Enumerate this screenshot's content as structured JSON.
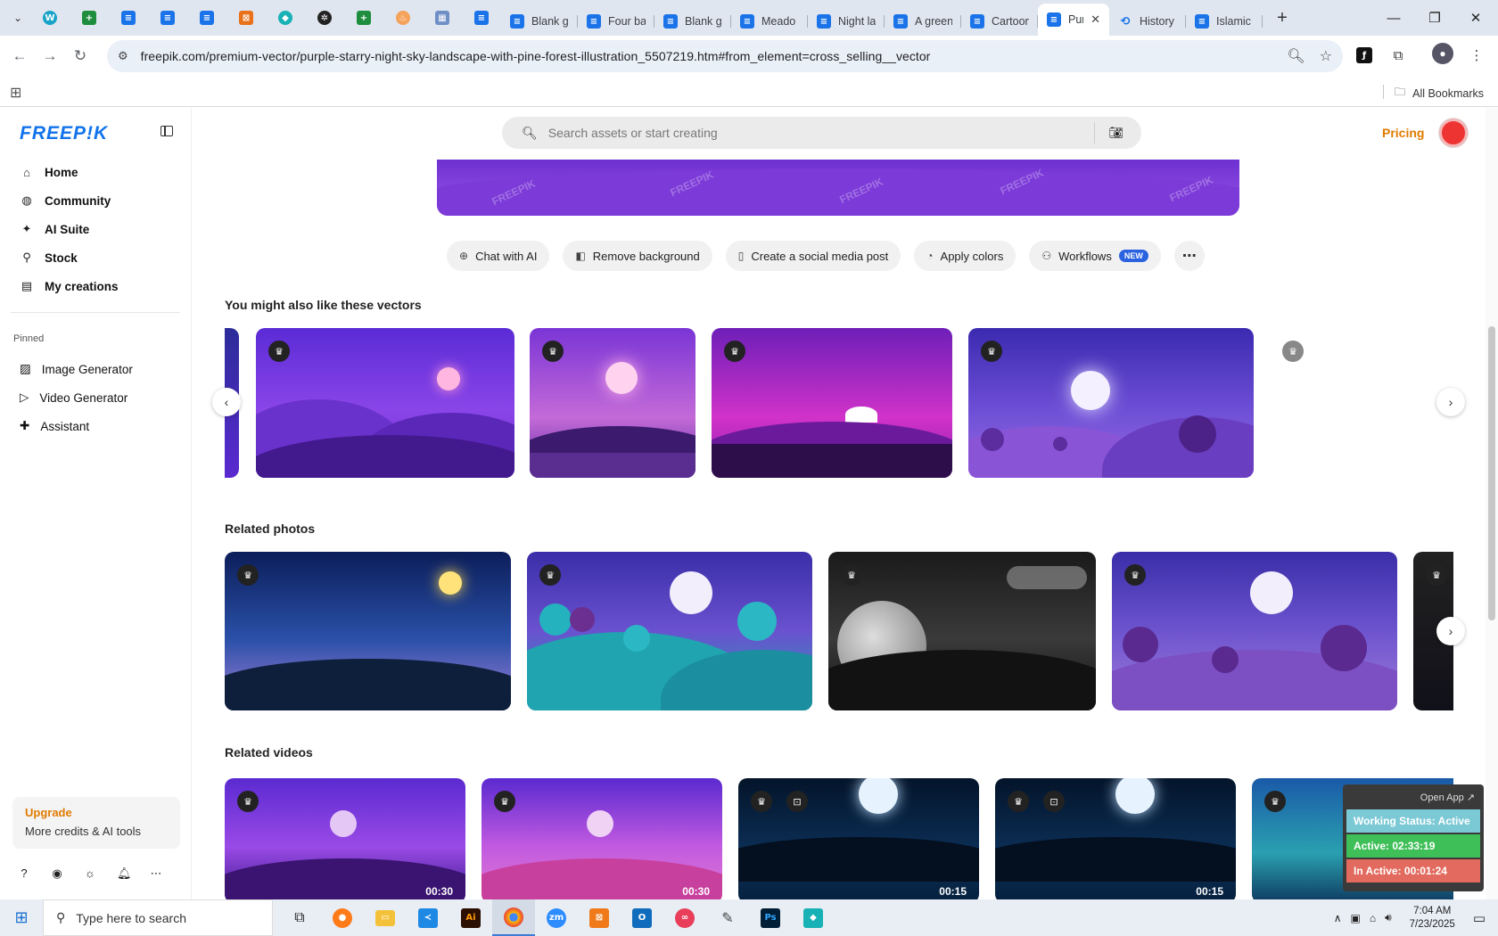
{
  "browser": {
    "tabs": [
      {
        "title": "Blank g",
        "icon": "docs-icon",
        "color": "#1a73e8"
      },
      {
        "title": "Four ba",
        "icon": "docs-icon",
        "color": "#1a73e8"
      },
      {
        "title": "Blank g",
        "icon": "docs-icon",
        "color": "#1a73e8"
      },
      {
        "title": "Meado",
        "icon": "docs-icon",
        "color": "#1a73e8"
      },
      {
        "title": "Night la",
        "icon": "docs-icon",
        "color": "#1a73e8"
      },
      {
        "title": "A green",
        "icon": "docs-icon",
        "color": "#1a73e8"
      },
      {
        "title": "Cartoon",
        "icon": "docs-icon",
        "color": "#1a73e8"
      },
      {
        "title": "Pur",
        "icon": "docs-icon",
        "color": "#1a73e8",
        "active": true
      },
      {
        "title": "History",
        "icon": "history-icon",
        "color": "#1a73e8"
      },
      {
        "title": "Islamic",
        "icon": "docs-icon",
        "color": "#1a73e8"
      }
    ],
    "url": "freepik.com/premium-vector/purple-starry-night-sky-landscape-with-pine-forest-illustration_5507219.htm#from_element=cross_selling__vector",
    "all_bookmarks": "All Bookmarks"
  },
  "sidebar": {
    "logo": "FREEP!K",
    "nav": [
      {
        "label": "Home",
        "icon": "home-icon"
      },
      {
        "label": "Community",
        "icon": "globe-icon"
      },
      {
        "label": "AI Suite",
        "icon": "sparkle-icon"
      },
      {
        "label": "Stock",
        "icon": "search-icon"
      },
      {
        "label": "My creations",
        "icon": "folder-icon"
      }
    ],
    "pinned_label": "Pinned",
    "pinned": [
      {
        "label": "Image Generator",
        "icon": "image-icon"
      },
      {
        "label": "Video Generator",
        "icon": "video-icon"
      },
      {
        "label": "Assistant",
        "icon": "assistant-icon"
      }
    ],
    "upgrade_title": "Upgrade",
    "upgrade_sub": "More credits & AI tools"
  },
  "topbar": {
    "search_placeholder": "Search assets or start creating",
    "pricing": "Pricing"
  },
  "actions": [
    {
      "label": "Chat with AI",
      "icon": "chat-plus-icon"
    },
    {
      "label": "Remove background",
      "icon": "remove-bg-icon"
    },
    {
      "label": "Create a social media post",
      "icon": "phone-icon"
    },
    {
      "label": "Apply colors",
      "icon": "palette-icon"
    },
    {
      "label": "Workflows",
      "icon": "workflow-icon",
      "badge": "NEW"
    }
  ],
  "sections": {
    "vectors_title": "You might also like these vectors",
    "photos_title": "Related photos",
    "videos_title": "Related videos"
  },
  "videos": [
    {
      "duration": "00:30"
    },
    {
      "duration": "00:30"
    },
    {
      "duration": "00:15"
    },
    {
      "duration": "00:15"
    },
    {
      "duration": ""
    }
  ],
  "widget": {
    "open_app": "Open App ↗",
    "status": "Working Status: Active",
    "active": "Active: 02:33:19",
    "inactive": "In Active: 00:01:24",
    "colors": {
      "status": "#7cc9d6",
      "active": "#3fbf57",
      "inactive": "#e26a5e"
    }
  },
  "taskbar": {
    "search_placeholder": "Type here to search",
    "time": "7:04 AM",
    "date": "7/23/2025"
  }
}
